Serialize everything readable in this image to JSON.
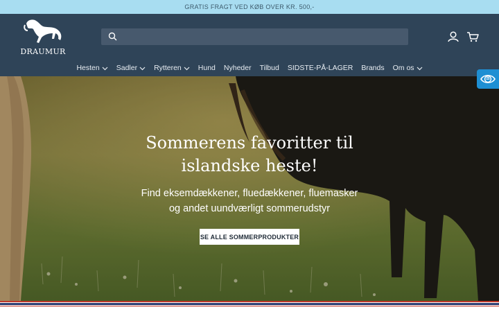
{
  "announcement": "GRATIS FRAGT VED KØB OVER KR. 500,-",
  "header": {
    "logo_text": "DRAUMUR",
    "search_placeholder": ""
  },
  "nav": {
    "items": [
      {
        "label": "Hesten",
        "dropdown": true
      },
      {
        "label": "Sadler",
        "dropdown": true
      },
      {
        "label": "Rytteren",
        "dropdown": true
      },
      {
        "label": "Hund",
        "dropdown": false
      },
      {
        "label": "Nyheder",
        "dropdown": false
      },
      {
        "label": "Tilbud",
        "dropdown": false
      },
      {
        "label": "SIDSTE-PÅ-LAGER",
        "dropdown": false
      },
      {
        "label": "Brands",
        "dropdown": false
      },
      {
        "label": "Om os",
        "dropdown": true
      }
    ]
  },
  "hero": {
    "title_line1": "Sommerens favoritter til",
    "title_line2": "islandske heste!",
    "subtitle_line1": "Find eksemdækkener, fluedækkener, fluemasker",
    "subtitle_line2": "og andet uundværligt sommerudstyr",
    "button": "SE ALLE SOMMERPRODUKTER"
  },
  "icons": {
    "search": "search-icon",
    "account": "user-icon",
    "cart": "cart-icon",
    "accessibility": "eye-icon"
  },
  "colors": {
    "announcement_bg": "#a8ddf1",
    "header_bg": "#2f4458",
    "accessibility_btn": "#1e8fd3"
  }
}
